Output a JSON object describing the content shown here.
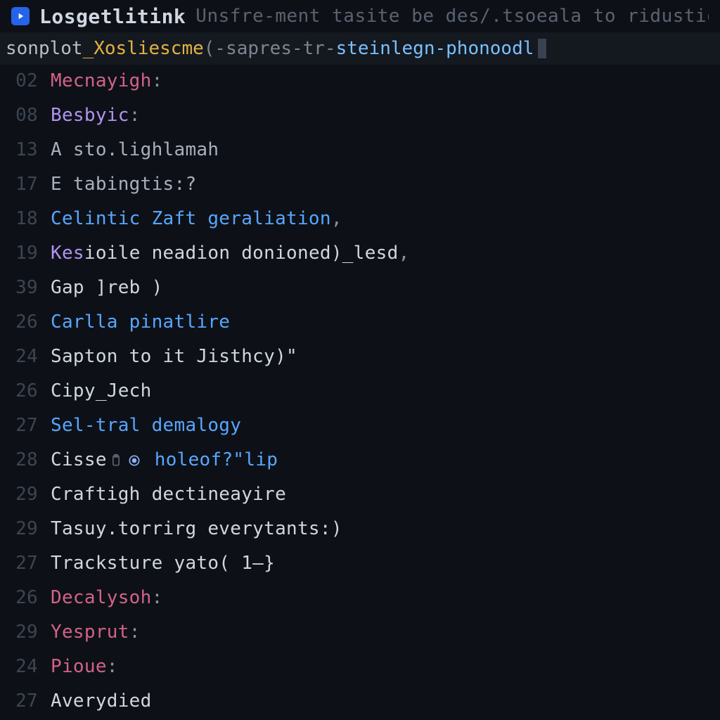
{
  "app": {
    "name": "Losgetlitink",
    "subtitle": "Unsfre-ment tasite be des/.tsoeala to ridustiones"
  },
  "cmd": {
    "seg0": "sonplot",
    "seg1": "_Xosliescme",
    "seg2": "(-sapres-tr-",
    "seg3": "steinlegn-phonoodl"
  },
  "lines": [
    {
      "num": "02",
      "tokens": [
        {
          "cls": "t-pink",
          "text": "Mecnayigh"
        },
        {
          "cls": "t-syntax",
          "text": ":"
        }
      ]
    },
    {
      "num": "08",
      "tokens": [
        {
          "cls": "t-purple",
          "text": "Besbyic"
        },
        {
          "cls": "t-syntax",
          "text": ":"
        }
      ]
    },
    {
      "num": "13",
      "tokens": [
        {
          "cls": "t-dim",
          "text": "A sto.lighlamah"
        }
      ]
    },
    {
      "num": "17",
      "tokens": [
        {
          "cls": "t-dim",
          "text": "E tabingtis:?"
        }
      ]
    },
    {
      "num": "18",
      "tokens": [
        {
          "cls": "t-blue",
          "text": "Celintic Zaft geraliation"
        },
        {
          "cls": "t-syntax",
          "text": ","
        }
      ]
    },
    {
      "num": "19",
      "tokens": [
        {
          "cls": "t-purple",
          "text": "Kes"
        },
        {
          "cls": "t-plain",
          "text": "ioile neadion donioned)_lesd"
        },
        {
          "cls": "t-syntax",
          "text": ","
        }
      ]
    },
    {
      "num": "39",
      "tokens": [
        {
          "cls": "t-plain",
          "text": "Gap ]reb )"
        }
      ]
    },
    {
      "num": "26",
      "tokens": [
        {
          "cls": "t-blue",
          "text": "Carlla pinatlire"
        }
      ]
    },
    {
      "num": "24",
      "tokens": [
        {
          "cls": "t-plain",
          "text": "Sapton to it Jisthcy)\""
        }
      ]
    },
    {
      "num": "26",
      "tokens": [
        {
          "cls": "t-plain",
          "text": "Cipy_Jech"
        }
      ]
    },
    {
      "num": "27",
      "tokens": [
        {
          "cls": "t-blue",
          "text": "Sel-tral demalogy"
        }
      ]
    },
    {
      "num": "28",
      "tokens": [
        {
          "cls": "t-plain",
          "text": "Cisse"
        },
        {
          "icon": "clipboard"
        },
        {
          "icon": "target"
        },
        {
          "cls": "t-blue",
          "text": " holeof?\"lip"
        }
      ]
    },
    {
      "num": "29",
      "tokens": [
        {
          "cls": "t-plain",
          "text": "Craftigh dectineayire"
        }
      ]
    },
    {
      "num": "29",
      "tokens": [
        {
          "cls": "t-plain",
          "text": "Tasuy.torrirg everytants:)"
        }
      ]
    },
    {
      "num": "27",
      "tokens": [
        {
          "cls": "t-plain",
          "text": "Tracksture yato( 1—}"
        }
      ]
    },
    {
      "num": "26",
      "tokens": [
        {
          "cls": "t-pink",
          "text": "Decalysoh"
        },
        {
          "cls": "t-syntax",
          "text": ":"
        }
      ]
    },
    {
      "num": "29",
      "tokens": [
        {
          "cls": "t-pink",
          "text": "Yesprut"
        },
        {
          "cls": "t-syntax",
          "text": ":"
        }
      ]
    },
    {
      "num": "24",
      "tokens": [
        {
          "cls": "t-pink",
          "text": "Pioue"
        },
        {
          "cls": "t-syntax",
          "text": ":"
        }
      ]
    },
    {
      "num": "27",
      "tokens": [
        {
          "cls": "t-plain",
          "text": "Averydied"
        }
      ]
    }
  ]
}
